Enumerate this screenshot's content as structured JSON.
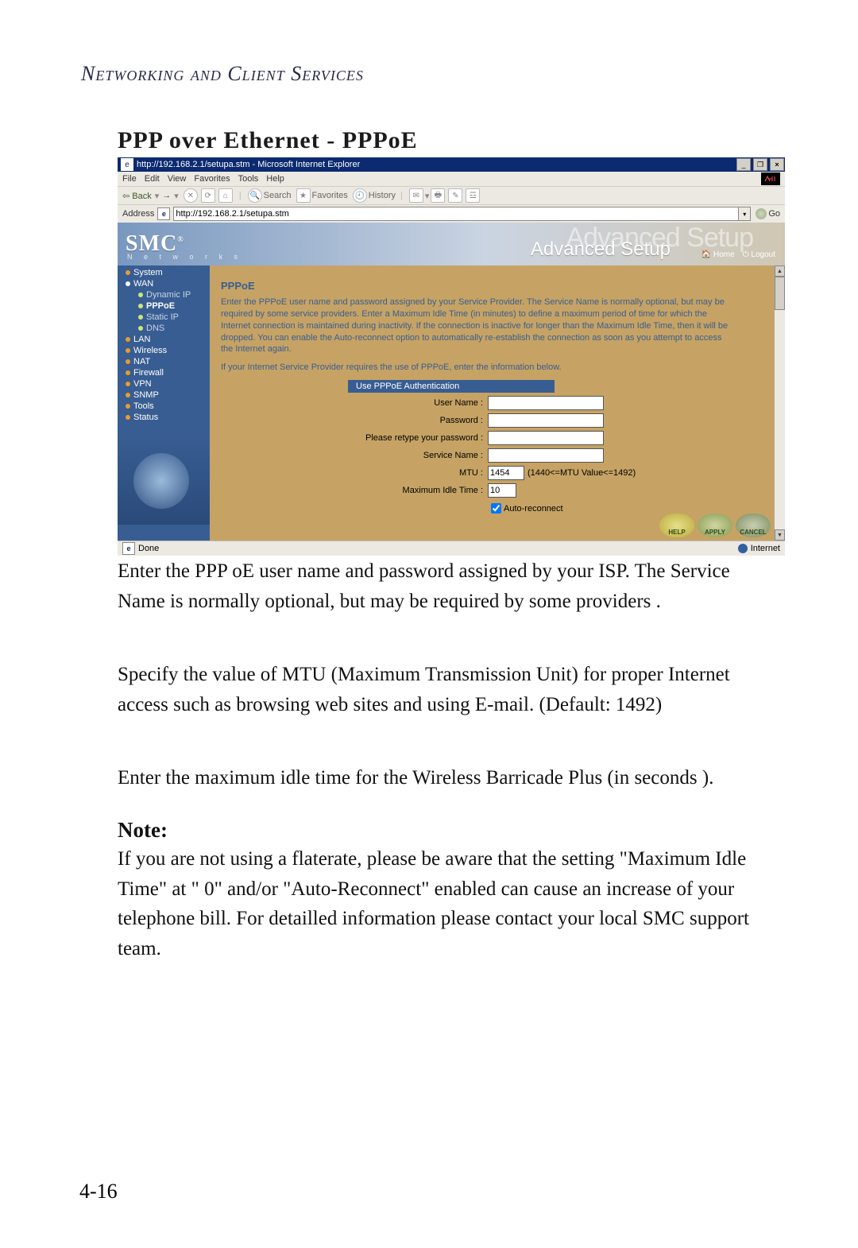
{
  "page": {
    "header": "Networking and Client Services",
    "section_title": "PPP over Ethernet  -  PPPoE",
    "page_number": "4-16"
  },
  "ie": {
    "titlebar": "http://192.168.2.1/setupa.stm - Microsoft Internet Explorer",
    "menu": {
      "file": "File",
      "edit": "Edit",
      "view": "View",
      "favorites": "Favorites",
      "tools": "Tools",
      "help": "Help"
    },
    "toolbar": {
      "back": "Back",
      "search": "Search",
      "favorites": "Favorites",
      "history": "History"
    },
    "addressbar_label": "Address",
    "addressbar_value": "http://192.168.2.1/setupa.stm",
    "go": "Go",
    "status_done": "Done",
    "status_right": "Internet"
  },
  "smc": {
    "logo": "SMC",
    "logo_sub": "N e t w o r k s",
    "adv_setup": "Advanced Setup",
    "adv_faded": "Advanced Setup",
    "home": "Home",
    "logout": "Logout"
  },
  "sidebar": {
    "items": [
      {
        "label": "System",
        "type": "top"
      },
      {
        "label": "WAN",
        "type": "top-open"
      },
      {
        "label": "Dynamic IP",
        "type": "sub"
      },
      {
        "label": "PPPoE",
        "type": "sub-active"
      },
      {
        "label": "Static IP",
        "type": "sub"
      },
      {
        "label": "DNS",
        "type": "sub"
      },
      {
        "label": "LAN",
        "type": "top"
      },
      {
        "label": "Wireless",
        "type": "top"
      },
      {
        "label": "NAT",
        "type": "top"
      },
      {
        "label": "Firewall",
        "type": "top"
      },
      {
        "label": "VPN",
        "type": "top"
      },
      {
        "label": "SNMP",
        "type": "top"
      },
      {
        "label": "Tools",
        "type": "top"
      },
      {
        "label": "Status",
        "type": "top"
      }
    ]
  },
  "content": {
    "heading": "PPPoE",
    "desc1": "Enter the PPPoE user name and password assigned by your Service Provider. The Service Name is normally optional, but may be required by some service providers.  Enter a Maximum Idle Time (in minutes) to define a maximum period of time for which the Internet connection is maintained during inactivity.  If the connection is inactive for longer than the Maximum Idle Time, then it will be dropped.  You can enable the Auto-reconnect option to automatically re-establish the connection as soon as you attempt to access the Internet again.",
    "desc2": "If your Internet Service Provider requires the use of PPPoE, enter the information below.",
    "form_header": "Use PPPoE Authentication",
    "username_label": "User Name :",
    "password_label": "Password :",
    "retype_label": "Please retype your password :",
    "service_label": "Service Name :",
    "mtu_label": "MTU :",
    "mtu_value": "1454",
    "mtu_hint": "(1440<=MTU Value<=1492)",
    "idle_label": "Maximum Idle Time :",
    "idle_value": "10",
    "autoreconnect": "Auto-reconnect",
    "btn_help": "HELP",
    "btn_apply": "APPLY",
    "btn_cancel": "CANCEL"
  },
  "body_text": {
    "p1": "Enter  the PPP oE user name and password assigned  by your ISP.  The Service Name  is normally optional, but may be required by some providers .",
    "p2": "Specify the value of MTU (Maximum Transmission  Unit) for proper Internet access such as  browsing web sites and using  E-mail. (Default: 1492)",
    "p3": "Enter the  maximum idle  time for the  Wireless Barricade Plus (in seconds ).",
    "note_head": "Note:",
    "note_body": "If you are not using a flaterate, please be aware that the setting \"Maximum Idle Time\" at \" 0\" and/or \"Auto-Reconnect\" enabled can cause an increase of your telephone bill. For detailled information please contact your local SMC support team."
  }
}
